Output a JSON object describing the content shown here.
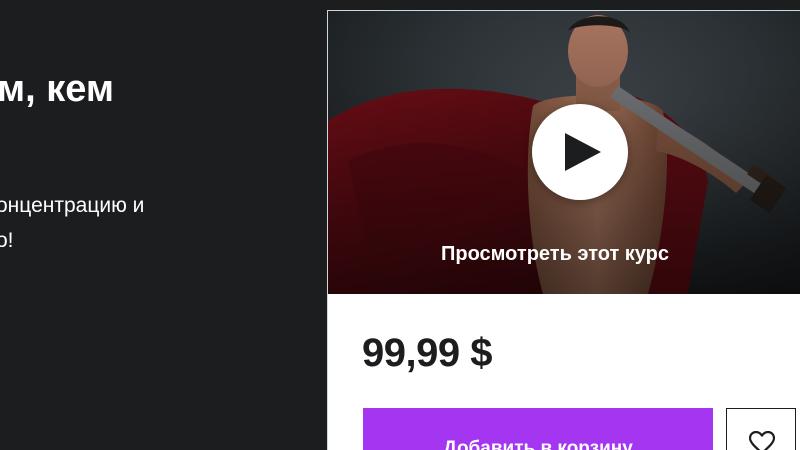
{
  "left": {
    "headline": "м, кем",
    "description": "онцентрацию и\nо!"
  },
  "card": {
    "preview_label": "Просмотреть этот курс",
    "price": "99,99 $",
    "add_to_cart_label": "Добавить в корзину",
    "icons": {
      "play": "play-icon",
      "wishlist": "heart-icon"
    }
  },
  "colors": {
    "background": "#1c1d1f",
    "accent": "#a435f0",
    "card": "#ffffff",
    "text_dark": "#1c1d1f"
  }
}
